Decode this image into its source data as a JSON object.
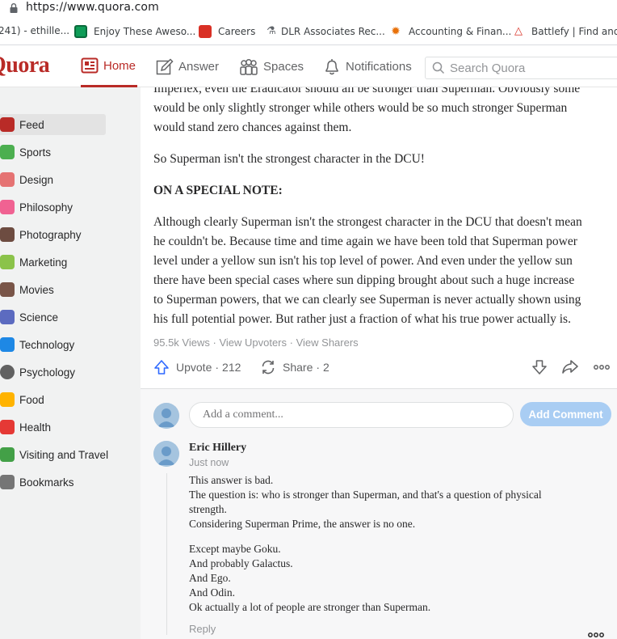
{
  "browser": {
    "url": "https://www.quora.com",
    "bookmarks": [
      {
        "label": "241) - ethille...",
        "icon": "tab-icon",
        "color": "#ffffff"
      },
      {
        "label": "Enjoy These Aweso...",
        "icon": "photo-icon",
        "color": "#0f9d58"
      },
      {
        "label": "Careers",
        "icon": "careers-icon",
        "color": "#d93025"
      },
      {
        "label": "DLR Associates Rec...",
        "icon": "figure-icon",
        "color": "#5f6368"
      },
      {
        "label": "Accounting & Finan...",
        "icon": "swirl-icon",
        "color": "#e8710a"
      },
      {
        "label": "Battlefy | Find and...",
        "icon": "battlefy-icon",
        "color": "#d93025"
      }
    ]
  },
  "header": {
    "logo": "Quora",
    "nav": [
      {
        "label": "Home",
        "icon": "home-icon"
      },
      {
        "label": "Answer",
        "icon": "pencil-icon"
      },
      {
        "label": "Spaces",
        "icon": "people-icon"
      },
      {
        "label": "Notifications",
        "icon": "bell-icon"
      }
    ],
    "search_placeholder": "Search Quora",
    "accent": "#b92b27"
  },
  "sidebar": {
    "items": [
      {
        "label": "Feed",
        "color": "#b92b27"
      },
      {
        "label": "Sports",
        "color": "#4caf50"
      },
      {
        "label": "Design",
        "color": "#e57373"
      },
      {
        "label": "Philosophy",
        "color": "#f06292"
      },
      {
        "label": "Photography",
        "color": "#6d4c41"
      },
      {
        "label": "Marketing",
        "color": "#8bc34a"
      },
      {
        "label": "Movies",
        "color": "#795548"
      },
      {
        "label": "Science",
        "color": "#5c6bc0"
      },
      {
        "label": "Technology",
        "color": "#1e88e5"
      },
      {
        "label": "Psychology",
        "color": "#616161"
      },
      {
        "label": "Food",
        "color": "#ffb300"
      },
      {
        "label": "Health",
        "color": "#e53935"
      },
      {
        "label": "Visiting and Travel",
        "color": "#43a047"
      },
      {
        "label": "Bookmarks",
        "color": "#757575"
      }
    ]
  },
  "answer": {
    "para1_line1": "Imperiex, even the Eradicator should all be stronger than Superman. Obviously some",
    "para1_line2": "would be only slightly stronger while others would be so much stronger Superman",
    "para1_line3": "would stand zero chances against them.",
    "para2": "So Superman isn't the strongest character in the DCU!",
    "note": "ON A SPECIAL NOTE:",
    "para3": [
      "Although clearly Superman isn't the strongest character in the DCU that doesn't mean",
      "he couldn't be. Because time and time again we have been told that Superman power",
      "level under a yellow sun isn't his top level of power. And even under the yellow sun",
      "there have been special cases where sun dipping brought about such a huge increase",
      "to Superman powers, that we can clearly see Superman is never actually shown using",
      "his full potential power. But rather just a fraction of what his true power actually is."
    ],
    "views": "95.5k Views",
    "view_upvoters": "View Upvoters",
    "view_sharers": "View Sharers",
    "upvote_label": "Upvote",
    "upvote_count": "212",
    "share_label": "Share",
    "share_count": "2"
  },
  "comments": {
    "input_placeholder": "Add a comment...",
    "add_button": "Add Comment",
    "list": [
      {
        "author": "Eric Hillery",
        "time": "Just now",
        "lines": [
          "This answer is bad.",
          "The question is: who is stronger than Superman, and that's a question of physical",
          "strength.",
          "Considering Superman Prime, the answer is no one."
        ],
        "lines2": [
          "Except maybe Goku.",
          "And probably Galactus.",
          "And Ego.",
          "And Odin.",
          "Ok actually a lot of people are stronger than Superman."
        ],
        "reply": "Reply"
      }
    ]
  }
}
